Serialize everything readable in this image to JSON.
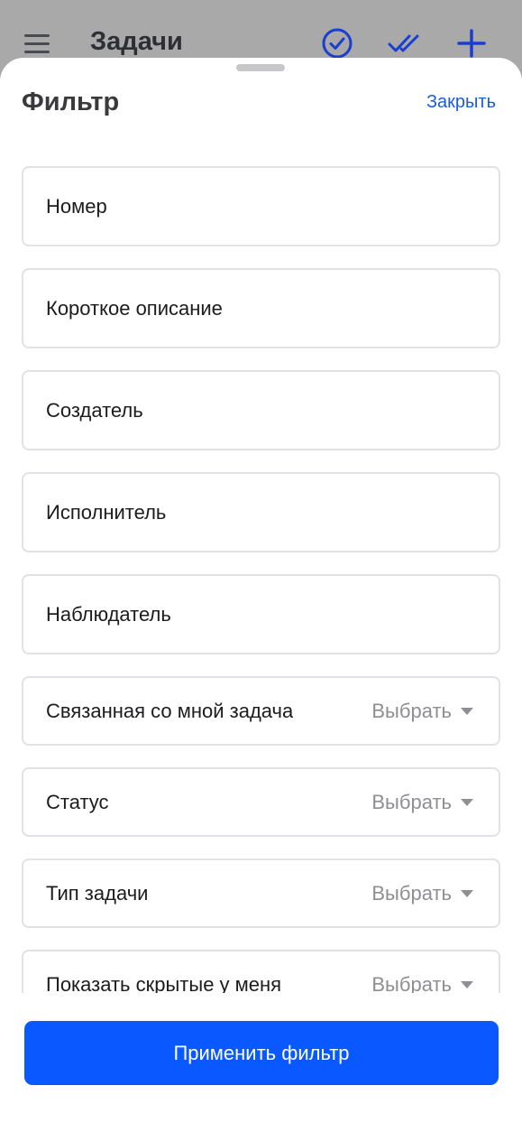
{
  "appbar": {
    "title": "Задачи",
    "icons": [
      "menu-icon",
      "check-circle-icon",
      "double-check-icon",
      "plus-icon"
    ],
    "accent_color": "#1a3fcf"
  },
  "sheet": {
    "title": "Фильтр",
    "close_label": "Закрыть"
  },
  "fields": {
    "number": {
      "label": "Номер"
    },
    "short_description": {
      "label": "Короткое описание"
    },
    "creator": {
      "label": "Создатель"
    },
    "assignee": {
      "label": "Исполнитель"
    },
    "observer": {
      "label": "Наблюдатель"
    },
    "related_task": {
      "label": "Связанная со мной задача",
      "value": "Выбрать"
    },
    "status": {
      "label": "Статус",
      "value": "Выбрать"
    },
    "task_type": {
      "label": "Тип задачи",
      "value": "Выбрать"
    },
    "show_hidden": {
      "label": "Показать скрытые у меня",
      "value": "Выбрать"
    }
  },
  "apply_button": {
    "label": "Применить фильтр"
  },
  "colors": {
    "primary": "#0a58ff",
    "link": "#1a5ce0",
    "field_border": "#e1e2e6",
    "placeholder": "#8e8e93"
  }
}
